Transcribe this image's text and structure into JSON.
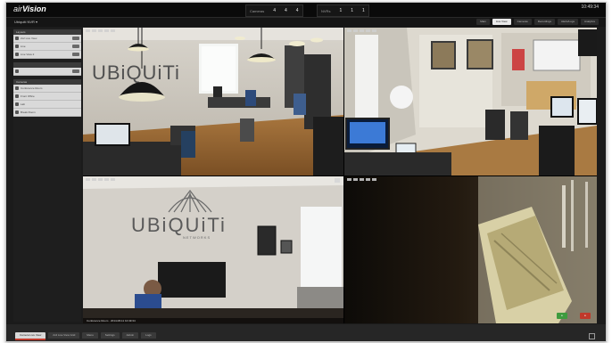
{
  "app": {
    "logo_prefix": "air",
    "logo_name": "Vision"
  },
  "stats": {
    "cameras_label": "Cameras",
    "cameras_values": [
      "4",
      "4",
      "4"
    ],
    "cameras_caps": [
      "",
      "",
      ""
    ],
    "nvr_label": "NVRs",
    "nvr_values": [
      "1",
      "1",
      "1"
    ],
    "nvr_caps": [
      "",
      "",
      ""
    ]
  },
  "clock": {
    "time": "10:49:34",
    "date": ""
  },
  "site": {
    "name": "Ubiquiti NVR"
  },
  "nav": {
    "tabs": [
      "Main",
      "Live View",
      "Cameras",
      "Recordings",
      "Alerts/Logs",
      "Analytics"
    ],
    "active_index": 1
  },
  "sidebar": {
    "sec1": "Layouts",
    "layout_items": [
      "2x2 Live View",
      "Live",
      "Live View 2"
    ],
    "sec2": "",
    "sec3": "Cameras",
    "camera_items": [
      "Conference Room",
      "Front Office",
      "Lab",
      "Break Room"
    ]
  },
  "cams": [
    {
      "name": "Ubiquiti Office"
    },
    {
      "name": ""
    },
    {
      "name": "Conference Room · 2014-08-11 10:49:34"
    },
    {
      "name": ""
    }
  ],
  "bottom": {
    "tabs": [
      "Camera Live View",
      "2x2 Live View Grid",
      "Menu",
      "Settings",
      "Admin",
      "Logs"
    ],
    "active_index": 0
  },
  "colors": {
    "accent": "#3e9b3e",
    "record": "#c0392b"
  }
}
